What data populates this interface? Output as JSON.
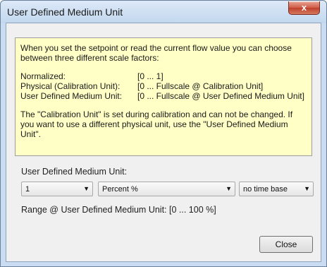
{
  "window": {
    "title": "User Defined Medium Unit",
    "close_glyph": "x"
  },
  "info": {
    "intro": "When you set the setpoint or read the current flow value you can choose between three different scale factors:",
    "factors": [
      {
        "name": "Normalized:",
        "range": "[0 ... 1]"
      },
      {
        "name": "Physical (Calibration Unit):",
        "range": "[0 ... Fullscale @ Calibration Unit]"
      },
      {
        "name": "User Defined Medium Unit:",
        "range": "[0 ... Fullscale @ User Defined Medium Unit]"
      }
    ],
    "note": "The \"Calibration Unit\" is set during calibration and can not be changed. If you want to use a different physical unit, use the \"User Defined Medium Unit\"."
  },
  "form": {
    "unit_label": "User Defined Medium Unit:",
    "factor_select": "1",
    "unit_select": "Percent %",
    "timebase_select": "no time base",
    "range_text": "Range @ User Defined Medium Unit:  [0 ... 100 %]"
  },
  "buttons": {
    "close": "Close"
  }
}
